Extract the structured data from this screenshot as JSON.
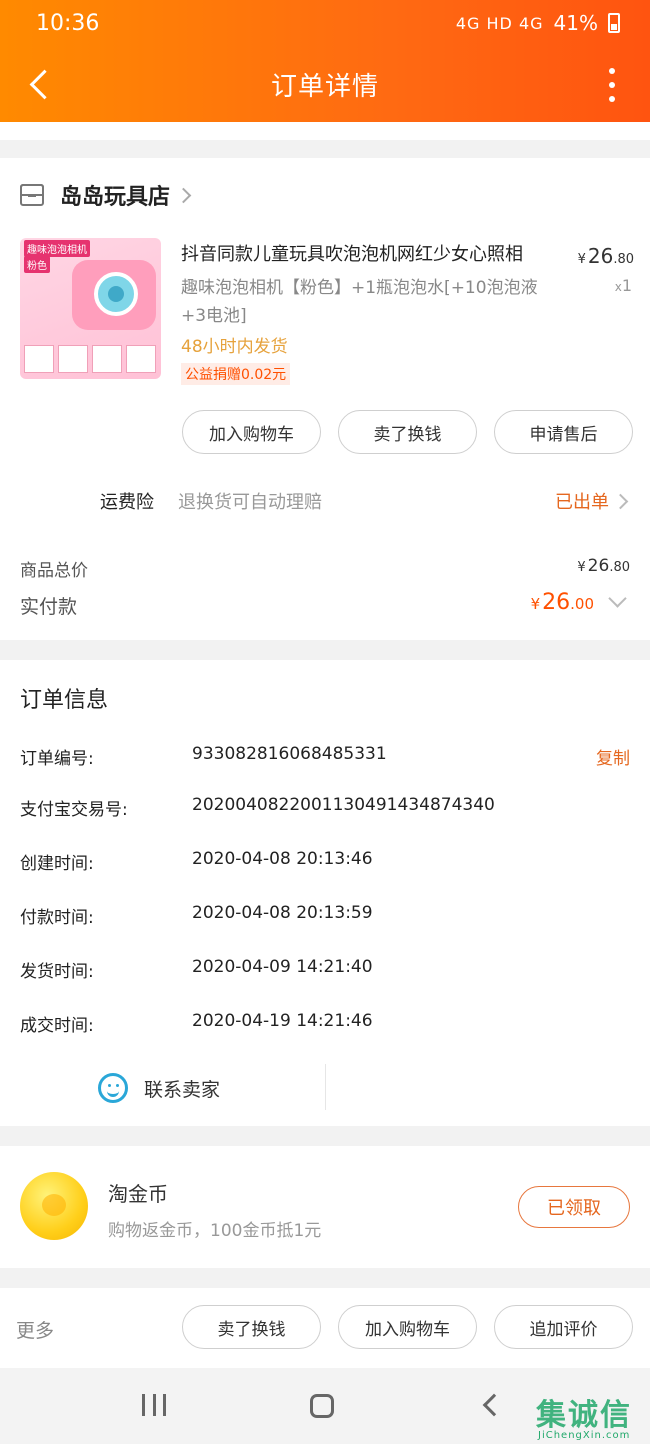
{
  "status_bar": {
    "time": "10:36",
    "network": "4G HD 4G",
    "battery": "41%"
  },
  "header": {
    "title": "订单详情"
  },
  "shop": {
    "name": "岛岛玩具店"
  },
  "product": {
    "title": "抖音同款儿童玩具吹泡泡机网红少女心照相",
    "sku_line1": "趣味泡泡相机【粉色】+1瓶泡泡水[+10泡泡液",
    "sku_line2": "+3电池]",
    "ship_tag": "48小时内发货",
    "charity": "公益捐赠0.02元",
    "price_currency": "¥",
    "price_int": "26",
    "price_dec": ".80",
    "qty_prefix": "x",
    "qty": "1",
    "thumb_label_1": "趣味泡泡相机",
    "thumb_label_2": "粉色"
  },
  "product_actions": {
    "add_cart": "加入购物车",
    "sell": "卖了换钱",
    "after_sale": "申请售后"
  },
  "insurance": {
    "label": "运费险",
    "desc": "退换货可自动理赔",
    "status": "已出单"
  },
  "totals": {
    "goods_label": "商品总价",
    "goods_currency": "¥",
    "goods_int": "26",
    "goods_dec": ".80",
    "paid_label": "实付款",
    "paid_currency": "¥",
    "paid_int": "26",
    "paid_dec": ".00"
  },
  "order_info": {
    "title": "订单信息",
    "copy_label": "复制",
    "rows": [
      {
        "label": "订单编号:",
        "value": "933082816068485331"
      },
      {
        "label": "支付宝交易号:",
        "value": "2020040822001130491434874340"
      },
      {
        "label": "创建时间:",
        "value": "2020-04-08 20:13:46"
      },
      {
        "label": "付款时间:",
        "value": "2020-04-08 20:13:59"
      },
      {
        "label": "发货时间:",
        "value": "2020-04-09 14:21:40"
      },
      {
        "label": "成交时间:",
        "value": "2020-04-19 14:21:46"
      }
    ],
    "contact_seller": "联系卖家"
  },
  "coins": {
    "title": "淘金币",
    "desc": "购物返金币，100金币抵1元",
    "button": "已领取"
  },
  "bottom_bar": {
    "more": "更多",
    "sell": "卖了换钱",
    "add_cart": "加入购物车",
    "review": "追加评价"
  },
  "watermark": {
    "text": "集诚信",
    "sub": "JiChengXin.com"
  },
  "colors": {
    "accent": "#ff5000",
    "header_start": "#ff8a00",
    "header_end": "#ff5410",
    "link_orange": "#e5671f"
  }
}
